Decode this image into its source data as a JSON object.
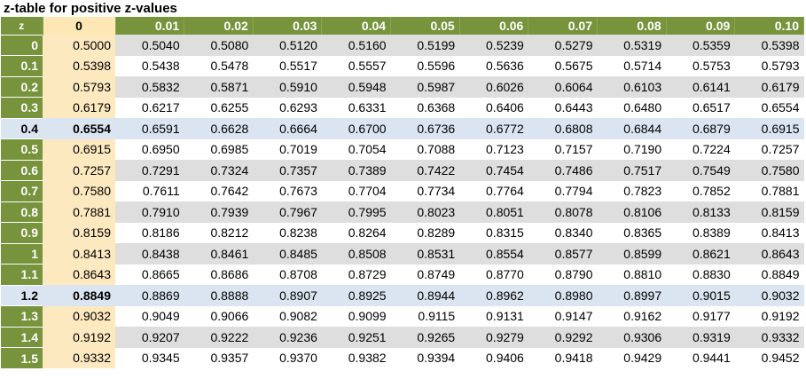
{
  "title": "z-table for positive z-values",
  "header": [
    "z",
    "0",
    "0.01",
    "0.02",
    "0.03",
    "0.04",
    "0.05",
    "0.06",
    "0.07",
    "0.08",
    "0.09",
    "0.10"
  ],
  "highlight_rows": [
    4,
    12
  ],
  "rows": [
    [
      "0",
      "0.5000",
      "0.5040",
      "0.5080",
      "0.5120",
      "0.5160",
      "0.5199",
      "0.5239",
      "0.5279",
      "0.5319",
      "0.5359",
      "0.5398"
    ],
    [
      "0.1",
      "0.5398",
      "0.5438",
      "0.5478",
      "0.5517",
      "0.5557",
      "0.5596",
      "0.5636",
      "0.5675",
      "0.5714",
      "0.5753",
      "0.5793"
    ],
    [
      "0.2",
      "0.5793",
      "0.5832",
      "0.5871",
      "0.5910",
      "0.5948",
      "0.5987",
      "0.6026",
      "0.6064",
      "0.6103",
      "0.6141",
      "0.6179"
    ],
    [
      "0.3",
      "0.6179",
      "0.6217",
      "0.6255",
      "0.6293",
      "0.6331",
      "0.6368",
      "0.6406",
      "0.6443",
      "0.6480",
      "0.6517",
      "0.6554"
    ],
    [
      "0.4",
      "0.6554",
      "0.6591",
      "0.6628",
      "0.6664",
      "0.6700",
      "0.6736",
      "0.6772",
      "0.6808",
      "0.6844",
      "0.6879",
      "0.6915"
    ],
    [
      "0.5",
      "0.6915",
      "0.6950",
      "0.6985",
      "0.7019",
      "0.7054",
      "0.7088",
      "0.7123",
      "0.7157",
      "0.7190",
      "0.7224",
      "0.7257"
    ],
    [
      "0.6",
      "0.7257",
      "0.7291",
      "0.7324",
      "0.7357",
      "0.7389",
      "0.7422",
      "0.7454",
      "0.7486",
      "0.7517",
      "0.7549",
      "0.7580"
    ],
    [
      "0.7",
      "0.7580",
      "0.7611",
      "0.7642",
      "0.7673",
      "0.7704",
      "0.7734",
      "0.7764",
      "0.7794",
      "0.7823",
      "0.7852",
      "0.7881"
    ],
    [
      "0.8",
      "0.7881",
      "0.7910",
      "0.7939",
      "0.7967",
      "0.7995",
      "0.8023",
      "0.8051",
      "0.8078",
      "0.8106",
      "0.8133",
      "0.8159"
    ],
    [
      "0.9",
      "0.8159",
      "0.8186",
      "0.8212",
      "0.8238",
      "0.8264",
      "0.8289",
      "0.8315",
      "0.8340",
      "0.8365",
      "0.8389",
      "0.8413"
    ],
    [
      "1",
      "0.8413",
      "0.8438",
      "0.8461",
      "0.8485",
      "0.8508",
      "0.8531",
      "0.8554",
      "0.8577",
      "0.8599",
      "0.8621",
      "0.8643"
    ],
    [
      "1.1",
      "0.8643",
      "0.8665",
      "0.8686",
      "0.8708",
      "0.8729",
      "0.8749",
      "0.8770",
      "0.8790",
      "0.8810",
      "0.8830",
      "0.8849"
    ],
    [
      "1.2",
      "0.8849",
      "0.8869",
      "0.8888",
      "0.8907",
      "0.8925",
      "0.8944",
      "0.8962",
      "0.8980",
      "0.8997",
      "0.9015",
      "0.9032"
    ],
    [
      "1.3",
      "0.9032",
      "0.9049",
      "0.9066",
      "0.9082",
      "0.9099",
      "0.9115",
      "0.9131",
      "0.9147",
      "0.9162",
      "0.9177",
      "0.9192"
    ],
    [
      "1.4",
      "0.9192",
      "0.9207",
      "0.9222",
      "0.9236",
      "0.9251",
      "0.9265",
      "0.9279",
      "0.9292",
      "0.9306",
      "0.9319",
      "0.9332"
    ],
    [
      "1.5",
      "0.9332",
      "0.9345",
      "0.9357",
      "0.9370",
      "0.9382",
      "0.9394",
      "0.9406",
      "0.9418",
      "0.9429",
      "0.9441",
      "0.9452"
    ]
  ],
  "colors": {
    "header_green": "#77933c",
    "zero_column": "#fde9c0",
    "row_stripe": "#dedede",
    "highlight_row": "#dbe5f1"
  }
}
